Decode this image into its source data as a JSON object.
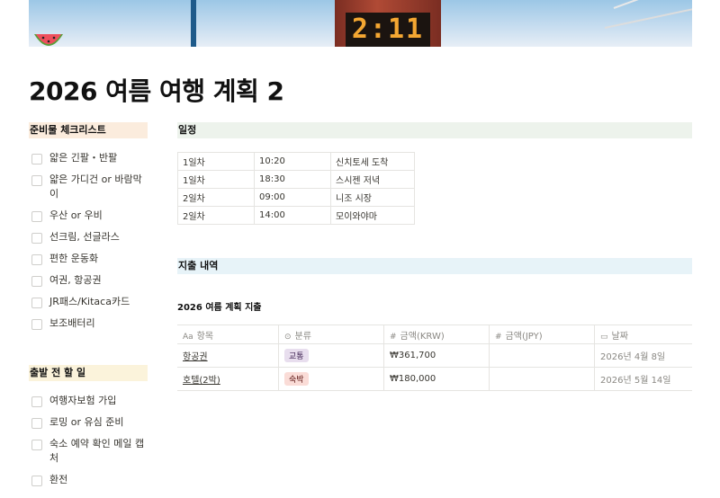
{
  "cover": {
    "clock_text": "2:11"
  },
  "page_icon": "watermelon-icon",
  "title": "2026 여름 여행 계획 2",
  "packing": {
    "heading": "준비물 체크리스트",
    "items": [
      "얇은 긴팔・반팔",
      "얇은 가디건 or 바람막이",
      "우산 or 우비",
      "선크림, 선글라스",
      "편한 운동화",
      "여권, 항공권",
      "JR패스/Kitaca카드",
      "보조배터리"
    ]
  },
  "todo_before": {
    "heading": "출발 전 할 일",
    "items": [
      "여행자보험 가입",
      "로밍 or 유심 준비",
      "숙소 예약 확인 메일 캡처",
      "환전"
    ]
  },
  "schedule": {
    "heading": "일정",
    "rows": [
      [
        "1일차",
        "10:20",
        "신치토세 도착"
      ],
      [
        "1일차",
        "18:30",
        "스시젠 저녁"
      ],
      [
        "2일차",
        "09:00",
        "니조 시장"
      ],
      [
        "2일차",
        "14:00",
        "모이와야마"
      ]
    ]
  },
  "expenses": {
    "heading": "지출 내역",
    "db_title": "2026 여름 계획 지출",
    "columns": {
      "item": {
        "icon": "Aa",
        "label": "항목"
      },
      "category": {
        "icon": "⊙",
        "label": "분류"
      },
      "krw": {
        "icon": "#",
        "label": "금액(KRW)"
      },
      "jpy": {
        "icon": "#",
        "label": "금액(JPY)"
      },
      "date": {
        "icon": "▭",
        "label": "날짜"
      }
    },
    "rows": [
      {
        "item": "항공권",
        "category": "교통",
        "category_color": "#e8deee",
        "krw": "₩361,700",
        "jpy": "",
        "date": "2026년 4월 8일"
      },
      {
        "item": "호텔(2박)",
        "category": "숙박",
        "category_color": "#fadcd7",
        "krw": "₩180,000",
        "jpy": "",
        "date": "2026년 5월 14일"
      }
    ]
  }
}
